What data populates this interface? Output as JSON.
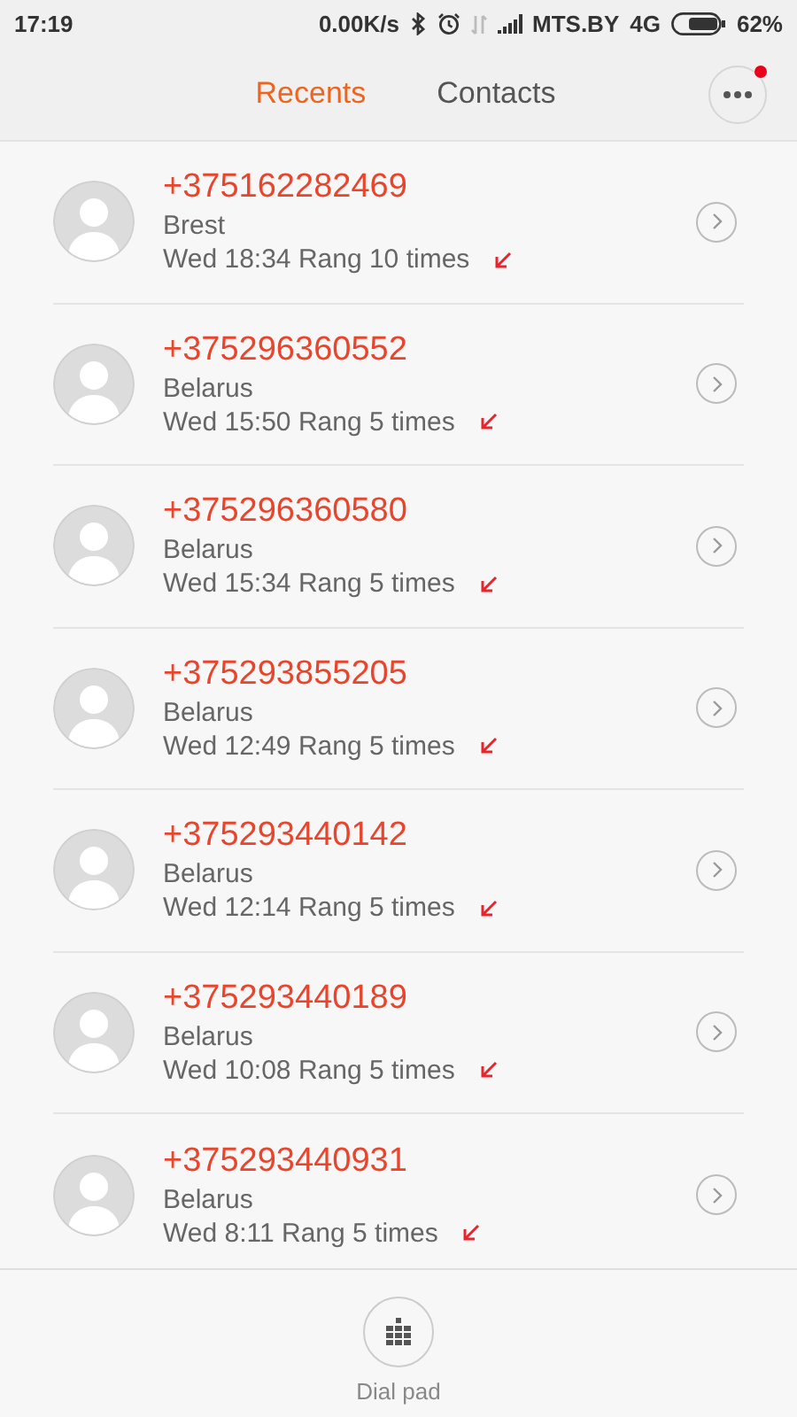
{
  "status_bar": {
    "time": "17:19",
    "speed": "0.00K/s",
    "carrier": "MTS.BY",
    "network": "4G",
    "battery": "62%"
  },
  "tabs": [
    {
      "label": "Recents",
      "selected": true
    },
    {
      "label": "Contacts",
      "selected": false
    }
  ],
  "menu_button": {
    "badge": true
  },
  "calls": [
    {
      "number": "+375162282469",
      "location": "Brest",
      "detail": "Wed 18:34 Rang 10 times"
    },
    {
      "number": "+375296360552",
      "location": "Belarus",
      "detail": "Wed 15:50 Rang 5 times"
    },
    {
      "number": "+375296360580",
      "location": "Belarus",
      "detail": "Wed 15:34 Rang 5 times"
    },
    {
      "number": "+375293855205",
      "location": "Belarus",
      "detail": "Wed 12:49 Rang 5 times"
    },
    {
      "number": "+375293440142",
      "location": "Belarus",
      "detail": "Wed 12:14 Rang 5 times"
    },
    {
      "number": "+375293440189",
      "location": "Belarus",
      "detail": "Wed 10:08 Rang 5 times"
    },
    {
      "number": "+375293440931",
      "location": "Belarus",
      "detail": "Wed 8:11 Rang 5 times"
    }
  ],
  "dial_pad": {
    "label": "Dial pad"
  }
}
